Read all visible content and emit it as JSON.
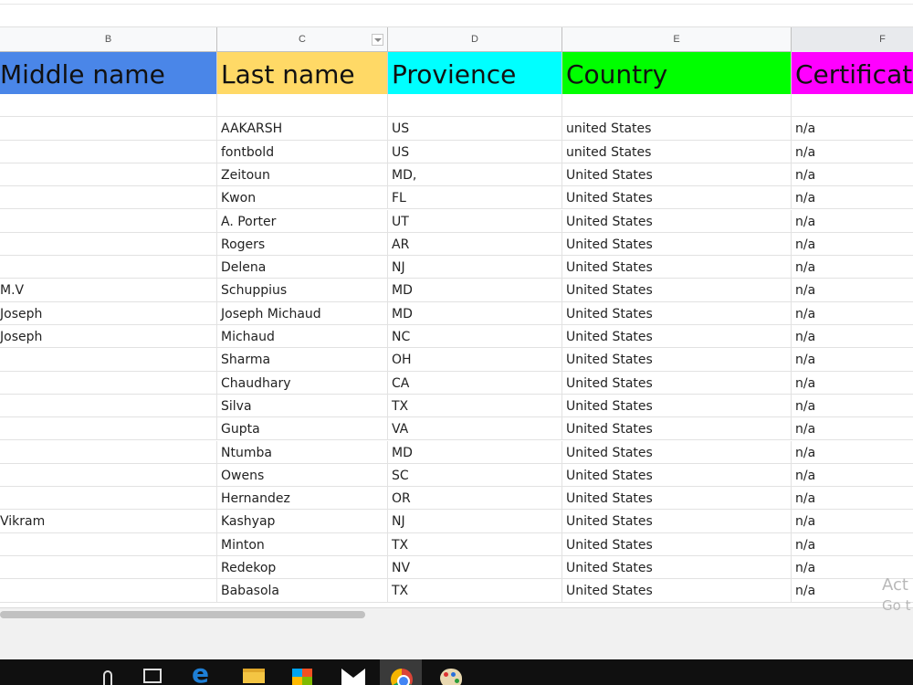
{
  "column_headers": [
    {
      "letter": "B"
    },
    {
      "letter": "C"
    },
    {
      "letter": "D"
    },
    {
      "letter": "E"
    },
    {
      "letter": "F"
    }
  ],
  "header_row": {
    "middle_name": "Middle name",
    "last_name": "Last name",
    "province": "Provience",
    "country": "Country",
    "certificate": "Certificate"
  },
  "colors": {
    "middle_name_bg": "#4a86e8",
    "last_name_bg": "#ffd966",
    "province_bg": "#00ffff",
    "country_bg": "#00ff00",
    "certificate_bg": "#ff00ff"
  },
  "rows": [
    {
      "middle": "",
      "last": "",
      "province": "",
      "country": "",
      "certificate": ""
    },
    {
      "middle": "",
      "last": "AAKARSH",
      "province": "US",
      "country": "united States",
      "certificate": "n/a"
    },
    {
      "middle": "",
      "last": "fontbold",
      "province": "US",
      "country": "united States",
      "certificate": "n/a"
    },
    {
      "middle": "",
      "last": "Zeitoun",
      "province": "MD,",
      "country": "United States",
      "certificate": "n/a"
    },
    {
      "middle": "",
      "last": "Kwon",
      "province": "FL",
      "country": "United States",
      "certificate": "n/a"
    },
    {
      "middle": "",
      "last": "A. Porter",
      "province": "UT",
      "country": "United States",
      "certificate": "n/a"
    },
    {
      "middle": "",
      "last": "Rogers",
      "province": "AR",
      "country": "United States",
      "certificate": "n/a"
    },
    {
      "middle": "",
      "last": "Delena",
      "province": "NJ",
      "country": "United States",
      "certificate": "n/a"
    },
    {
      "middle": "M.V",
      "last": "Schuppius",
      "province": "MD",
      "country": "United States",
      "certificate": "n/a"
    },
    {
      "middle": "Joseph",
      "last": "Joseph Michaud",
      "province": "MD",
      "country": "United States",
      "certificate": "n/a"
    },
    {
      "middle": "Joseph",
      "last": "Michaud",
      "province": "NC",
      "country": "United States",
      "certificate": "n/a"
    },
    {
      "middle": "",
      "last": "Sharma",
      "province": "OH",
      "country": "United States",
      "certificate": "n/a"
    },
    {
      "middle": "",
      "last": "Chaudhary",
      "province": "CA",
      "country": "United States",
      "certificate": "n/a"
    },
    {
      "middle": "",
      "last": "Silva",
      "province": "TX",
      "country": "United States",
      "certificate": "n/a"
    },
    {
      "middle": "",
      "last": "Gupta",
      "province": "VA",
      "country": "United States",
      "certificate": "n/a"
    },
    {
      "middle": "",
      "last": "Ntumba",
      "province": "MD",
      "country": "United States",
      "certificate": "n/a"
    },
    {
      "middle": "",
      "last": "Owens",
      "province": "SC",
      "country": "United States",
      "certificate": "n/a"
    },
    {
      "middle": "",
      "last": "Hernandez",
      "province": "OR",
      "country": "United States",
      "certificate": "n/a"
    },
    {
      "middle": "Vikram",
      "last": "Kashyap",
      "province": "NJ",
      "country": "United States",
      "certificate": "n/a"
    },
    {
      "middle": "",
      "last": "Minton",
      "province": "TX",
      "country": "United States",
      "certificate": "n/a"
    },
    {
      "middle": "",
      "last": "Redekop",
      "province": "NV",
      "country": "United States",
      "certificate": "n/a"
    },
    {
      "middle": "",
      "last": "Babasola",
      "province": "TX",
      "country": "United States",
      "certificate": "n/a"
    }
  ],
  "watermark": {
    "line1": "Act",
    "line2": "Go t"
  },
  "taskbar": {
    "items": [
      {
        "icon": "microphone-icon"
      },
      {
        "icon": "task-view-icon"
      },
      {
        "icon": "edge-icon",
        "glyph": "e"
      },
      {
        "icon": "file-explorer-icon"
      },
      {
        "icon": "store-icon"
      },
      {
        "icon": "mail-icon"
      },
      {
        "icon": "chrome-icon",
        "active": true
      },
      {
        "icon": "paint-icon"
      }
    ]
  }
}
